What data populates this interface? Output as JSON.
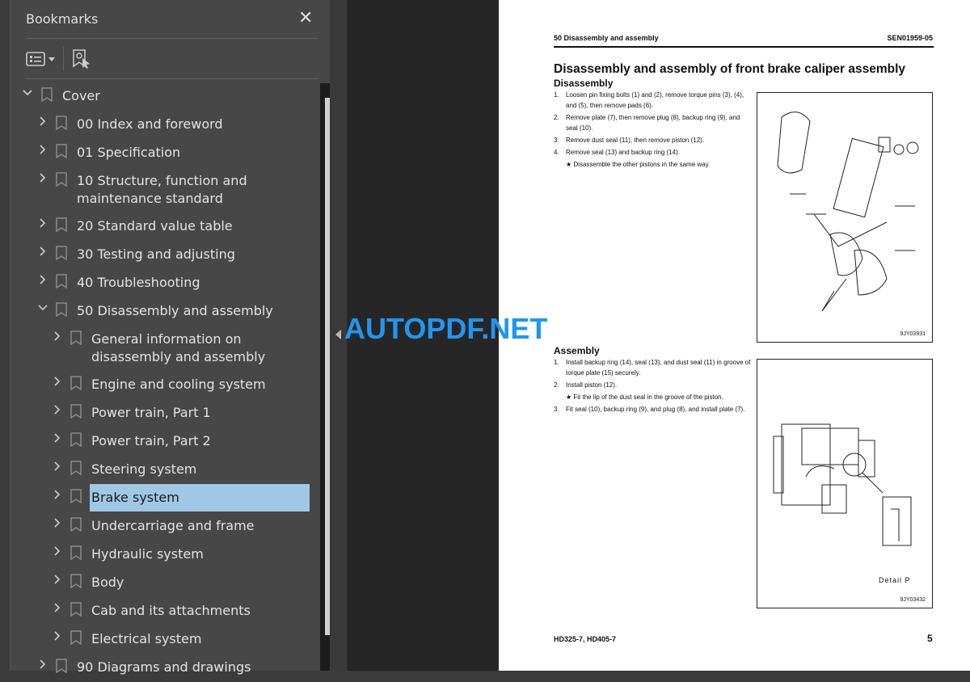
{
  "panel": {
    "title": "Bookmarks",
    "close": "✕"
  },
  "tree": [
    {
      "label": "Cover",
      "level": 0,
      "expanded": true
    },
    {
      "label": "00 Index and foreword",
      "level": 1
    },
    {
      "label": "01 Specification",
      "level": 1
    },
    {
      "label": "10 Structure, function and maintenance standard",
      "level": 1
    },
    {
      "label": "20 Standard value table",
      "level": 1
    },
    {
      "label": "30 Testing and adjusting",
      "level": 1
    },
    {
      "label": "40 Troubleshooting",
      "level": 1
    },
    {
      "label": "50 Disassembly and assembly",
      "level": 1,
      "expanded": true
    },
    {
      "label": "General information on disassembly and assembly",
      "level": 2
    },
    {
      "label": "Engine and cooling system",
      "level": 2
    },
    {
      "label": "Power train, Part 1",
      "level": 2
    },
    {
      "label": "Power train, Part 2",
      "level": 2
    },
    {
      "label": "Steering system",
      "level": 2
    },
    {
      "label": "Brake system",
      "level": 2,
      "selected": true
    },
    {
      "label": "Undercarriage and frame",
      "level": 2
    },
    {
      "label": "Hydraulic system",
      "level": 2
    },
    {
      "label": "Body",
      "level": 2
    },
    {
      "label": "Cab and its attachments",
      "level": 2
    },
    {
      "label": "Electrical system",
      "level": 2
    },
    {
      "label": "90 Diagrams and drawings",
      "level": 1
    }
  ],
  "watermark": "AUTOPDF.NET",
  "page": {
    "header_left": "50 Disassembly and assembly",
    "header_right": "SEN01959-05",
    "title": "Disassembly and assembly of front brake caliper assembly",
    "disassembly": {
      "heading": "Disassembly",
      "steps": [
        {
          "n": "1.",
          "text": "Loosen pin fixing bolts (1) and (2), remove torque pins (3), (4), and (5), then remove pads (6)."
        },
        {
          "n": "2.",
          "text": "Remove plate (7), then remove plug (8), backup ring (9), and seal (10)."
        },
        {
          "n": "3.",
          "text": "Remove dust seal (11), then remove piston (12)."
        },
        {
          "n": "4.",
          "text": "Remove seal (13) and backup ring (14)."
        }
      ],
      "note": "★  Disassemble the other pistons in the same way."
    },
    "assembly": {
      "heading": "Assembly",
      "steps": [
        {
          "n": "1.",
          "text": "Install backup ring (14), seal (13), and dust seal (11) in groove of torque plate (15) securely."
        },
        {
          "n": "2.",
          "text": "Install piston (12)."
        },
        {
          "n": "3.",
          "text": "Fit seal (10), backup ring (9), and plug (8), and install plate (7)."
        }
      ],
      "note": "★  Fit the lip of the dust seal in the groove of the piston."
    },
    "fig1_code": "9JY03931",
    "fig2_code": "9JY03432",
    "fig2_detail": "Detail P",
    "footer_left": "HD325-7, HD405-7",
    "page_number": "5"
  },
  "colors": {
    "selection": "#9fc8e4",
    "watermark": "#2196f0"
  }
}
